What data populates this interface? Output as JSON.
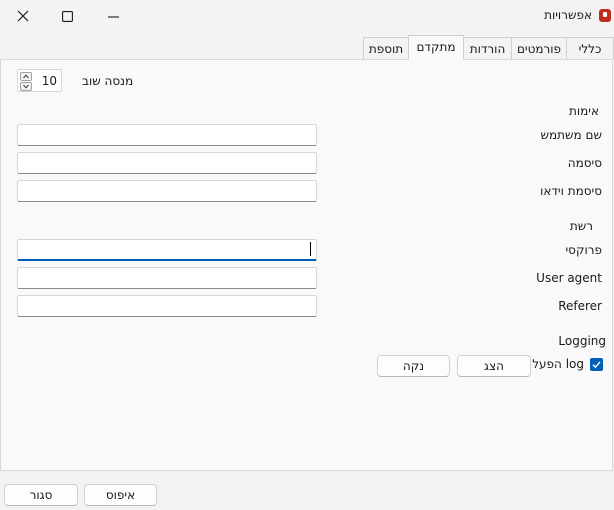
{
  "window": {
    "title": "אפשרויות",
    "close_icon": "close-icon",
    "maximize_icon": "maximize-icon",
    "minimize_icon": "minimize-icon"
  },
  "tabs": [
    {
      "label": "כללי",
      "active": false
    },
    {
      "label": "פורמטים",
      "active": false
    },
    {
      "label": "הורדות",
      "active": false
    },
    {
      "label": "מתקדם",
      "active": true
    },
    {
      "label": "תוספת",
      "active": false
    }
  ],
  "retry": {
    "label": "מנסה שוב",
    "value": "10"
  },
  "auth": {
    "section_label": "אימות",
    "username_label": "שם משתמש",
    "username_value": "",
    "password_label": "סיסמה",
    "password_value": "",
    "video_password_label": "סיסמת וידאו",
    "video_password_value": ""
  },
  "network": {
    "section_label": "רשת",
    "proxy_label": "פרוקסי",
    "proxy_value": "",
    "user_agent_label": "User agent",
    "user_agent_value": "",
    "referer_label": "Referer",
    "referer_value": ""
  },
  "logging": {
    "section_label": "Logging",
    "enable_label": "הפעל log",
    "enabled": true,
    "show_label": "הצג",
    "clear_label": "נקה"
  },
  "footer": {
    "reset_label": "איפוס",
    "close_label": "סגור"
  },
  "colors": {
    "accent": "#005fb8",
    "app_icon": "#c42b1c"
  }
}
